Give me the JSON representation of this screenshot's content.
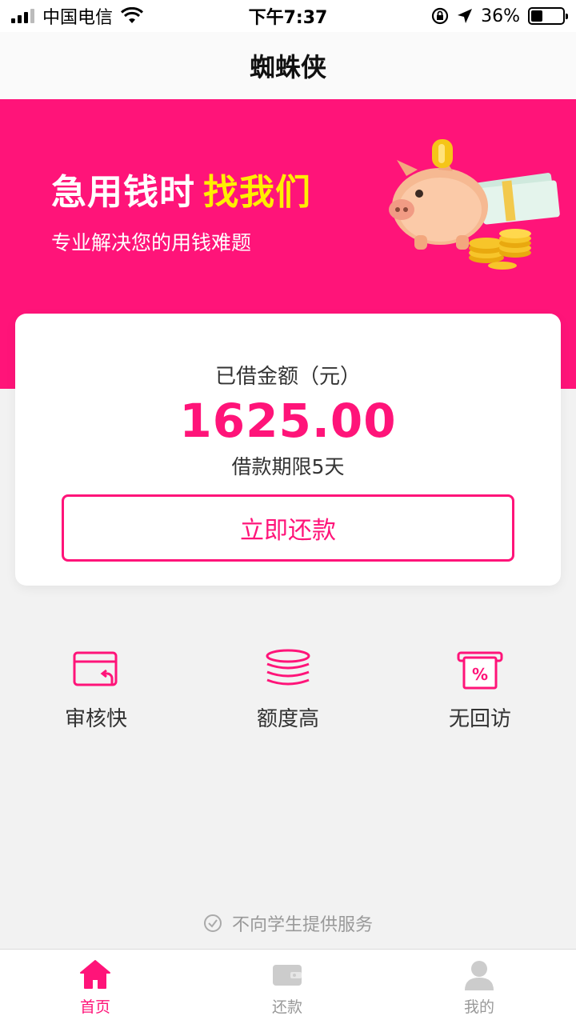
{
  "status_bar": {
    "carrier": "中国电信",
    "time": "下午7:37",
    "battery": "36%",
    "battery_level": 0.36
  },
  "nav": {
    "title": "蜘蛛侠"
  },
  "hero": {
    "title_main": "急用钱时",
    "title_highlight": "找我们",
    "subtitle": "专业解决您的用钱难题"
  },
  "card": {
    "label": "已借金额（元）",
    "amount": "1625.00",
    "term": "借款期限5天",
    "button": "立即还款"
  },
  "features": [
    {
      "label": "审核快",
      "icon": "card-return-icon"
    },
    {
      "label": "额度高",
      "icon": "coin-stack-icon"
    },
    {
      "label": "无回访",
      "icon": "percent-receipt-icon"
    }
  ],
  "disclaimer": "不向学生提供服务",
  "tabs": [
    {
      "label": "首页",
      "icon": "home-icon",
      "active": true
    },
    {
      "label": "还款",
      "icon": "wallet-icon",
      "active": false
    },
    {
      "label": "我的",
      "icon": "user-icon",
      "active": false
    }
  ],
  "colors": {
    "accent": "#ff1479",
    "highlight": "#ffee00",
    "background": "#f2f2f2",
    "inactive": "#cccccc"
  }
}
